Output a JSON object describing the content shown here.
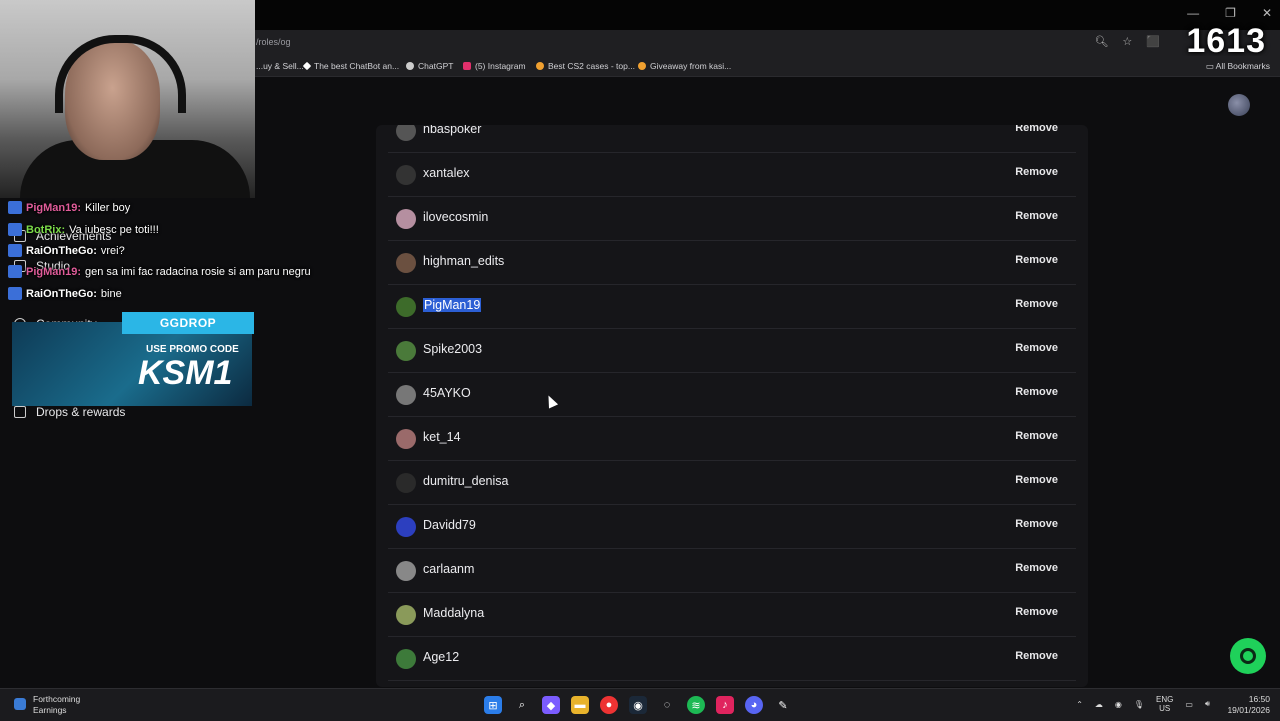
{
  "browser": {
    "url": "/roles/og",
    "counter": "1613",
    "bookmarks": [
      {
        "label": "...uy & Sell...",
        "color": "#888888"
      },
      {
        "label": "The best ChatBot an...",
        "color": "#ffffff"
      },
      {
        "label": "ChatGPT",
        "color": "#cccccc"
      },
      {
        "label": "(5) Instagram",
        "color": "#e1306c"
      },
      {
        "label": "Best CS2 cases - top...",
        "color": "#f0a030"
      },
      {
        "label": "Giveaway from kasi...",
        "color": "#f0a030"
      }
    ],
    "all_bookmarks": "All Bookmarks"
  },
  "members": [
    {
      "name": "nbaspoker",
      "color": "#555555"
    },
    {
      "name": "xantalex",
      "color": "#333333"
    },
    {
      "name": "ilovecosmin",
      "color": "#b58fa0"
    },
    {
      "name": "highman_edits",
      "color": "#6b5040"
    },
    {
      "name": "PigMan19",
      "color": "#3d6b2a",
      "selected": true
    },
    {
      "name": "Spike2003",
      "color": "#4a7a3a"
    },
    {
      "name": "45AYKO",
      "color": "#777777"
    },
    {
      "name": "ket_14",
      "color": "#9a6a6a"
    },
    {
      "name": "dumitru_denisa",
      "color": "#2a2a2a"
    },
    {
      "name": "Davidd79",
      "color": "#2c3fbf"
    },
    {
      "name": "carlaanm",
      "color": "#888888"
    },
    {
      "name": "Maddalyna",
      "color": "#8a9a5a"
    },
    {
      "name": "Age12",
      "color": "#3d7a3a"
    }
  ],
  "remove_label": "Remove",
  "sidebar": {
    "achievements": "Achievements",
    "studio": "Studio",
    "community": "Community",
    "drops": "Drops & rewards"
  },
  "chat": [
    {
      "user": "PigMan19:",
      "msg": "Killer boy",
      "color": "#e05c9a"
    },
    {
      "user": "BotRix:",
      "msg": "Va iubesc pe toti!!!",
      "color": "#7cdc4a"
    },
    {
      "user": "RaiOnTheGo:",
      "msg": "vrei?",
      "color": "#ffffff"
    },
    {
      "user": "PigMan19:",
      "msg": "gen sa imi fac radacina rosie si am paru negru",
      "color": "#e05c9a"
    },
    {
      "user": "RaiOnTheGo:",
      "msg": "bine",
      "color": "#ffffff"
    }
  ],
  "promo": {
    "brand": "GGDROP",
    "line": "USE PROMO CODE",
    "code": "KSM1"
  },
  "taskbar": {
    "weather_title": "Forthcoming",
    "weather_sub": "Earnings",
    "lang": "ENG",
    "region": "US",
    "time": "16:50",
    "date": "19/01/2026"
  }
}
